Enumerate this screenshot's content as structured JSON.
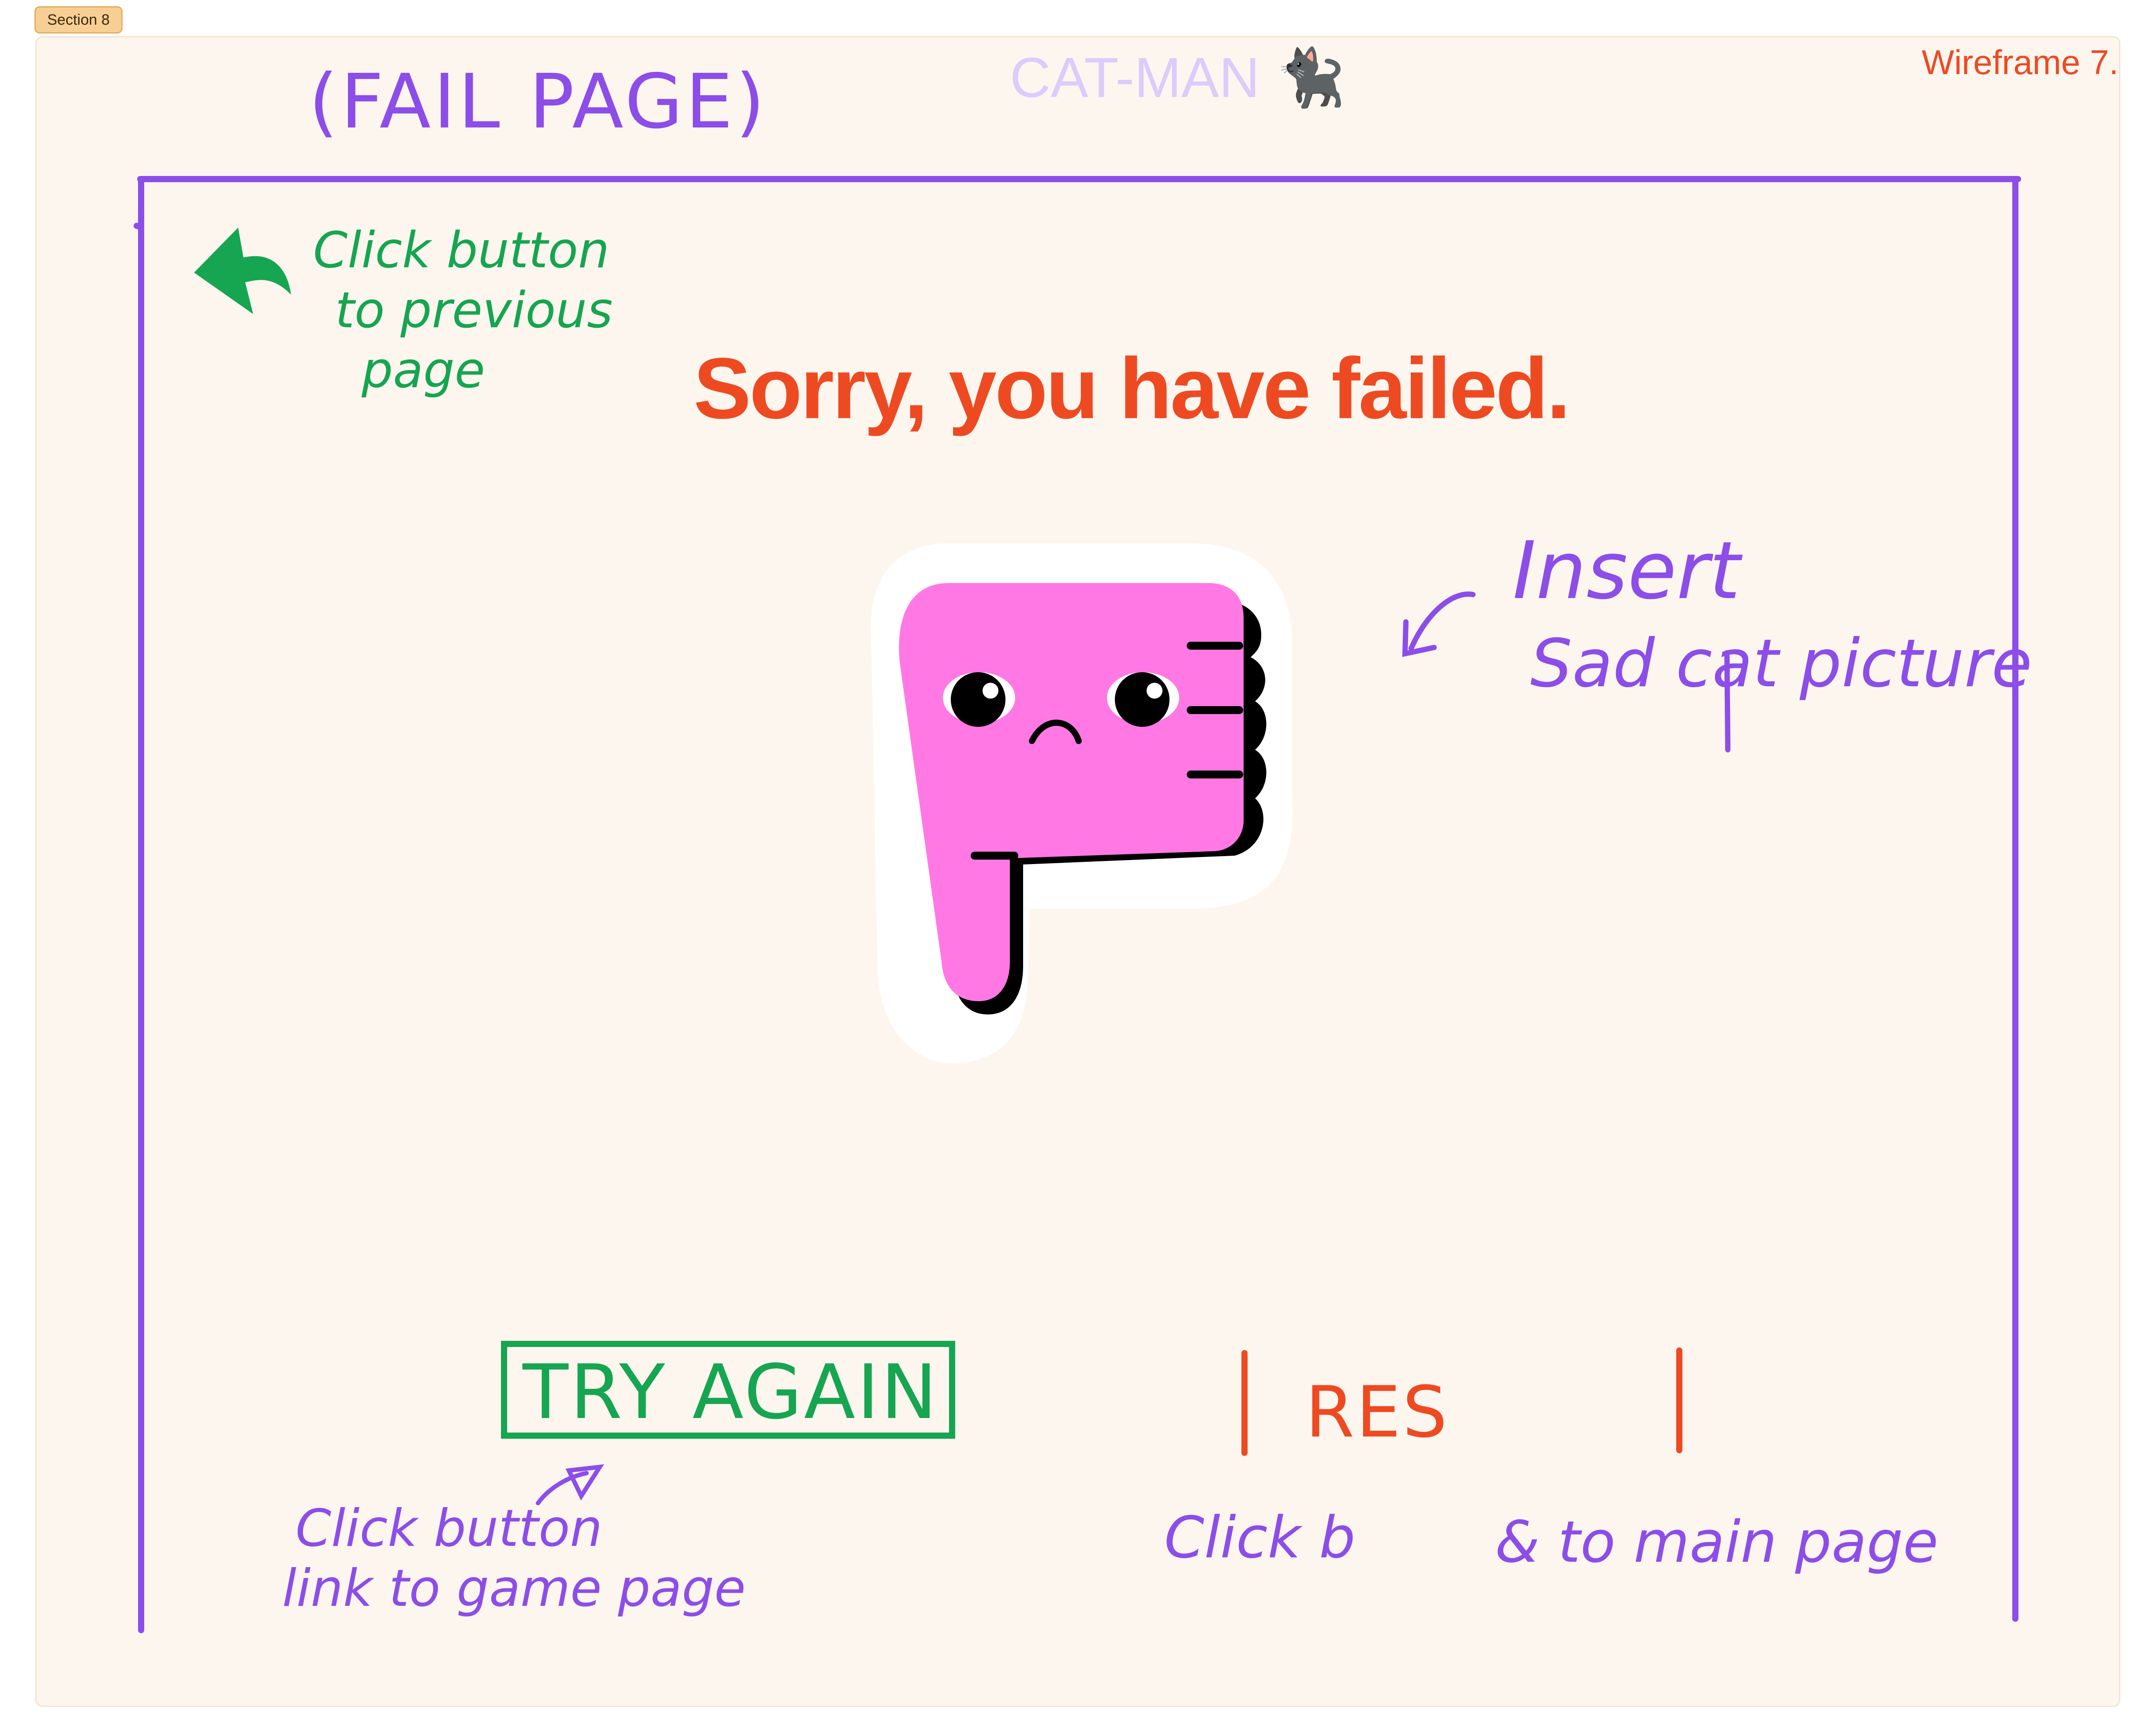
{
  "section_tag": "Section 8",
  "header": {
    "app_title": "CAT-MAN",
    "app_emoji": "🐈‍⬛",
    "wireframe_label": "Wireframe 7."
  },
  "annotations": {
    "page_title": "(FAIL PAGE)",
    "back_note": [
      "Click button",
      "to previous",
      "page"
    ],
    "image_note": [
      "Insert",
      "Sad cat picture"
    ],
    "try_note": [
      "Click button",
      "link to game page"
    ],
    "res_note_left": "Click b",
    "res_note_right": "& to main page"
  },
  "main": {
    "headline": "Sorry, you have failed.",
    "try_again_label": "TRY AGAIN",
    "restart_label": "RES"
  },
  "colors": {
    "frame_purple": "#8c4de8",
    "note_green": "#16a550",
    "accent_red": "#ee4a22",
    "thumb_pink": "#ff78e4",
    "section_bg": "#fdf6ef"
  },
  "icons": {
    "back": "back-arrow-icon",
    "image": "thumbs-down-sticker",
    "pointer": "arrow-pointer"
  }
}
